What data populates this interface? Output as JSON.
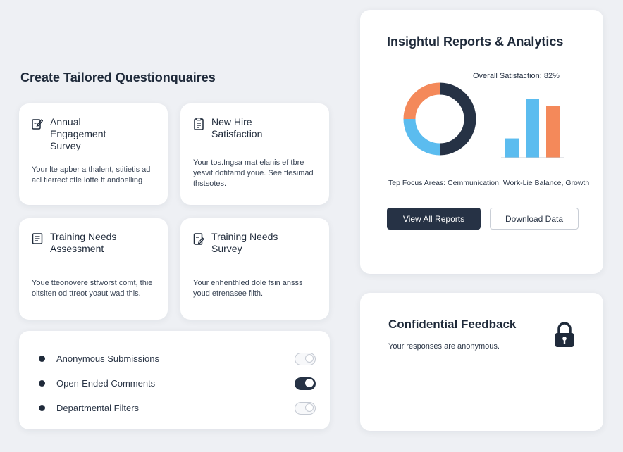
{
  "questionnaires": {
    "title": "Create Tailored Questionquaires",
    "cards": [
      {
        "icon": "edit-form-icon",
        "title": "Annual Engagement Survey",
        "desc": "Your lte apber a thalent, stitietis ad acl tierrect ctle lotte ft andoelling"
      },
      {
        "icon": "document-list-icon",
        "title": "New Hire Satisfaction",
        "desc": "Your tos.Ingsa mat elanis ef tbre yesvit dotitamd youe. See ftesimad thstsotes."
      },
      {
        "icon": "document-lines-icon",
        "title": "Training Needs Assessment",
        "desc": "Youe tteonovere stfworst comt, thie oitsiten od ttreot yoaut wad this."
      },
      {
        "icon": "clipboard-edit-icon",
        "title": "Training Needs Survey",
        "desc": "Your enhenthled dole fsin ansss youd etrenasee flith."
      }
    ]
  },
  "features": [
    {
      "label": "Anonymous Submissions",
      "on": false
    },
    {
      "label": "Open-Ended Comments",
      "on": true
    },
    {
      "label": "Departmental Filters",
      "on": false
    }
  ],
  "reports": {
    "title": "Insightul Reports & Analytics",
    "satisfaction": "Overall Satisfaction: 82%",
    "focus": "Tep Focus Areas: Cemmunication, Work-Lie Balance, Growth",
    "view_all": "View All Reports",
    "download": "Download Data",
    "donut": {
      "segments": [
        {
          "value": 50,
          "color": "#263245"
        },
        {
          "value": 25,
          "color": "#5bbcef"
        },
        {
          "value": 25,
          "color": "#f4895a"
        }
      ]
    },
    "bars": [
      {
        "value": 28,
        "color": "#5bbcef"
      },
      {
        "value": 85,
        "color": "#5bbcef"
      },
      {
        "value": 75,
        "color": "#f4895a"
      }
    ]
  },
  "confidential": {
    "title": "Confidential Feedback",
    "desc": "Your responses are anonymous.",
    "icon": "lock-icon"
  },
  "colors": {
    "accent": "#263245",
    "blue": "#5bbcef",
    "orange": "#f4895a"
  }
}
